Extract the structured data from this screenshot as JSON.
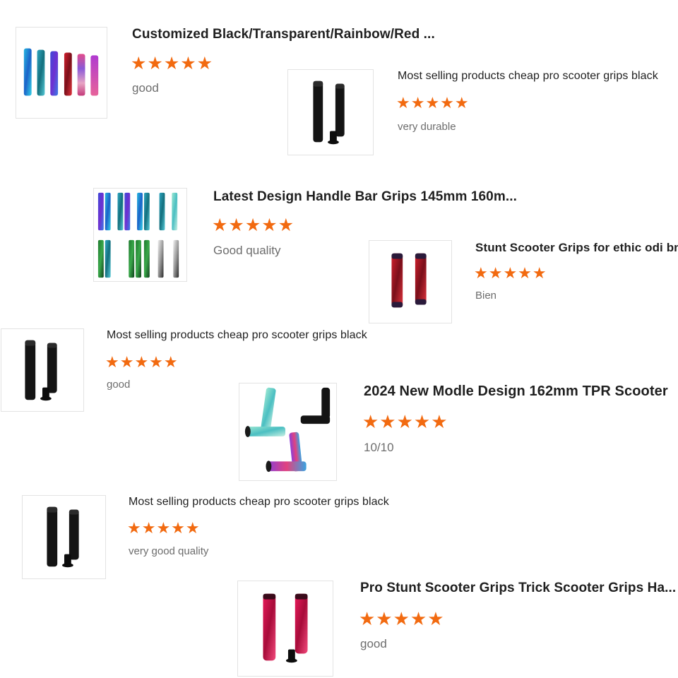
{
  "reviews": [
    {
      "title": "Customized Black/Transparent/Rainbow/Red ...",
      "stars": "★★★★★",
      "rating": 5,
      "text": "good",
      "thumb_icon": "colorful-grips-row-image"
    },
    {
      "title": "Most selling products cheap pro scooter grips black",
      "stars": "★★★★★",
      "rating": 5,
      "text": "very durable",
      "thumb_icon": "black-grips-pair-image"
    },
    {
      "title": "Latest Design Handle Bar Grips 145mm 160m...",
      "stars": "★★★★★",
      "rating": 5,
      "text": "Good quality",
      "thumb_icon": "multicolor-grips-grid-image"
    },
    {
      "title": "Stunt Scooter Grips for ethic odi bmx",
      "stars": "★★★★★",
      "rating": 5,
      "text": "Bien",
      "thumb_icon": "red-marble-grips-image"
    },
    {
      "title": "Most selling products cheap pro scooter grips black",
      "stars": "★★★★★",
      "rating": 5,
      "text": "good",
      "thumb_icon": "black-grips-pair-image"
    },
    {
      "title": "2024 New Modle Design 162mm TPR Scooter",
      "stars": "★★★★★",
      "rating": 5,
      "text": "10/10",
      "thumb_icon": "mixed-color-grips-image"
    },
    {
      "title": "Most selling products cheap pro scooter grips black",
      "stars": "★★★★★",
      "rating": 5,
      "text": "very good quality",
      "thumb_icon": "black-grips-pair-image"
    },
    {
      "title": "Pro Stunt Scooter Grips Trick Scooter Grips Ha...",
      "stars": "★★★★★",
      "rating": 5,
      "text": "good",
      "thumb_icon": "red-pink-grips-image"
    }
  ],
  "colors": {
    "star": "#f26a10",
    "title": "#1f1f1f",
    "review_text": "#6d6d6d",
    "thumb_border": "#e3e3e3"
  }
}
